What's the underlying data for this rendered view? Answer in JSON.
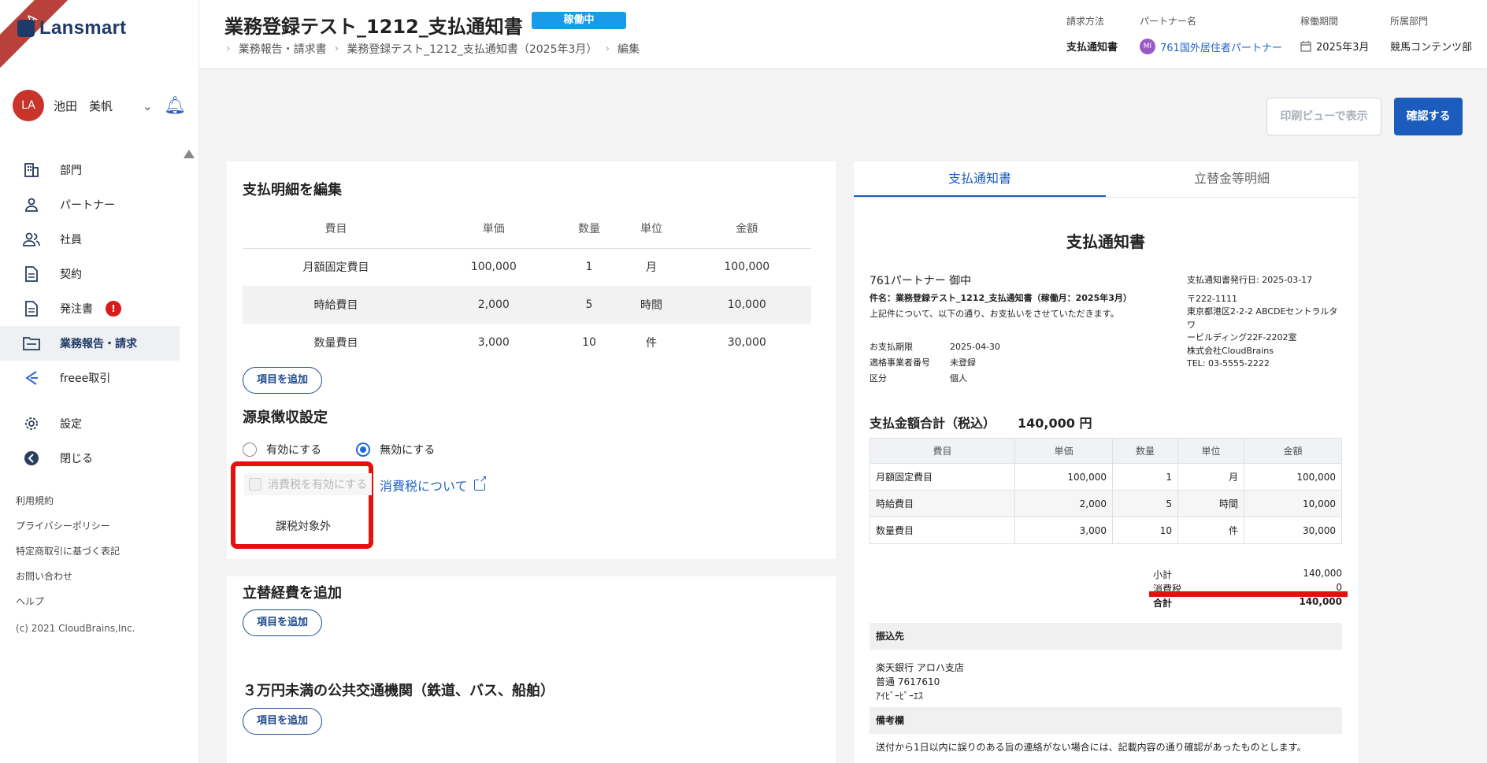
{
  "ribbon": "QA",
  "app": {
    "logo_text": "Lansmart"
  },
  "user": {
    "initials": "LA",
    "name": "池田　美帆"
  },
  "nav": {
    "items": [
      {
        "label": "部門",
        "icon": "building-icon"
      },
      {
        "label": "パートナー",
        "icon": "person-icon"
      },
      {
        "label": "社員",
        "icon": "people-icon"
      },
      {
        "label": "契約",
        "icon": "document-icon"
      },
      {
        "label": "発注書",
        "icon": "document-icon",
        "badge": "!"
      },
      {
        "label": "業務報告・請求",
        "icon": "folder-icon",
        "active": true
      },
      {
        "label": "freee取引",
        "icon": "freee-icon"
      }
    ],
    "settings": "設定",
    "close": "閉じる"
  },
  "footer": {
    "links": [
      "利用規約",
      "プライバシーポリシー",
      "特定商取引に基づく表記",
      "お問い合わせ",
      "ヘルプ"
    ],
    "copyright": "(c) 2021 CloudBrains,Inc."
  },
  "header": {
    "title": "業務登録テスト_1212_支払通知書",
    "status": "稼働中",
    "breadcrumb": [
      "業務報告・請求書",
      "業務登録テスト_1212_支払通知書（2025年3月）",
      "編集"
    ],
    "meta": {
      "billing_method_label": "請求方法",
      "billing_method": "支払通知書",
      "partner_label": "パートナー名",
      "partner_initials": "MI",
      "partner": "761国外居住者パートナー",
      "period_label": "稼働期間",
      "period": "2025年3月",
      "dept_label": "所属部門",
      "dept": "競馬コンテンツ部"
    }
  },
  "actions": {
    "print_preview": "印刷ビューで表示",
    "confirm": "確認する"
  },
  "edit": {
    "title": "支払明細を編集",
    "columns": [
      "費目",
      "単価",
      "数量",
      "単位",
      "金額"
    ],
    "rows": [
      [
        "月額固定費目",
        "100,000",
        "1",
        "月",
        "100,000"
      ],
      [
        "時給費目",
        "2,000",
        "5",
        "時間",
        "10,000"
      ],
      [
        "数量費目",
        "3,000",
        "10",
        "件",
        "30,000"
      ]
    ],
    "add_item": "項目を追加",
    "withholding_title": "源泉徴収設定",
    "radio_enable": "有効にする",
    "radio_disable": "無効にする",
    "tax_checkbox": "消費税を有効にする",
    "tax_link": "消費税について",
    "tax_status": "課税対象外",
    "expense_title": "立替経費を追加",
    "transport_title": "３万円未満の公共交通機関（鉄道、バス、船舶）"
  },
  "preview": {
    "tabs": [
      "支払通知書",
      "立替金等明細"
    ],
    "doc_title": "支払通知書",
    "addressee": "761パートナー 御中",
    "subject": "件名：業務登録テスト_1212_支払通知書（稼働月：2025年3月）",
    "intro": "上記件について、以下の通り、お支払いをさせていただきます。",
    "due_label": "お支払期限",
    "due": "2025-04-30",
    "reg_label": "適格事業者番号",
    "reg": "未登録",
    "type_label": "区分",
    "type": "個人",
    "issue_date": "支払通知書発行日: 2025-03-17",
    "postal": "〒222-1111",
    "address1": "東京都港区2-2-2 ABCDEセントラルタワ",
    "address2": "ービルディング22F-2202室",
    "company": "株式会社CloudBrains",
    "tel": "TEL: 03-5555-2222",
    "total_label": "支払金額合計（税込）",
    "total": "140,000 円",
    "columns": [
      "費目",
      "単価",
      "数量",
      "単位",
      "金額"
    ],
    "rows": [
      [
        "月額固定費目",
        "100,000",
        "1",
        "月",
        "100,000"
      ],
      [
        "時給費目",
        "2,000",
        "5",
        "時間",
        "10,000"
      ],
      [
        "数量費目",
        "3,000",
        "10",
        "件",
        "30,000"
      ]
    ],
    "subtotal_label": "小計",
    "subtotal": "140,000",
    "tax_label": "消費税",
    "tax": "0",
    "grand_label": "合計",
    "grand": "140,000",
    "bank_heading": "振込先",
    "bank_line1": "楽天銀行 アロハ支店",
    "bank_line2": "普通 7617610",
    "bank_line3": "ｱｲﾋﾞｰﾋﾟｰｴｽ",
    "remarks_heading": "備考欄",
    "remarks": "送付から1日以内に誤りのある旨の連絡がない場合には、記載内容の通り確認があったものとします。"
  }
}
